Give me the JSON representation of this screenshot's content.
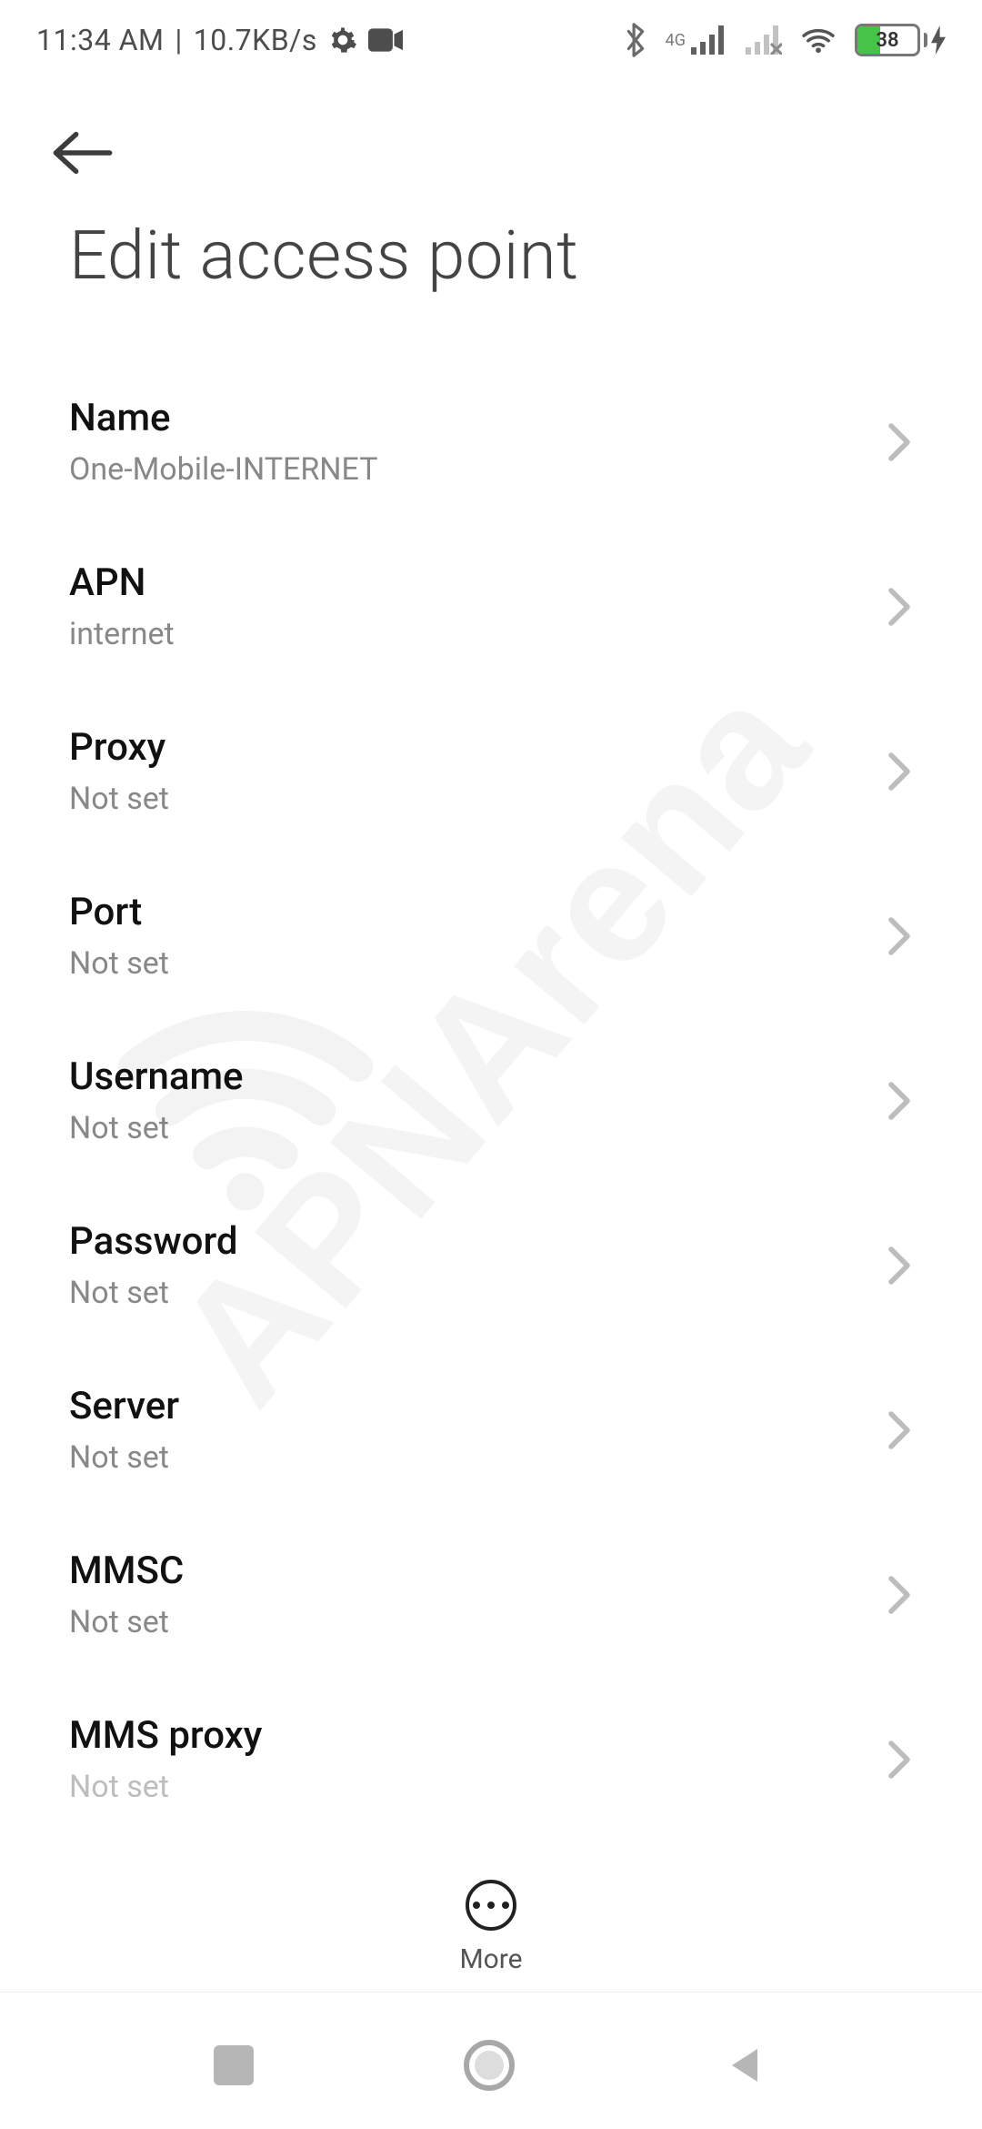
{
  "status": {
    "time": "11:34 AM",
    "network_rate": "10.7KB/s",
    "battery_percent": "38",
    "carrier_tag": "4G"
  },
  "page": {
    "title": "Edit access point",
    "settings": [
      {
        "key": "name",
        "label": "Name",
        "value": "One-Mobile-INTERNET"
      },
      {
        "key": "apn",
        "label": "APN",
        "value": "internet"
      },
      {
        "key": "proxy",
        "label": "Proxy",
        "value": "Not set"
      },
      {
        "key": "port",
        "label": "Port",
        "value": "Not set"
      },
      {
        "key": "username",
        "label": "Username",
        "value": "Not set"
      },
      {
        "key": "password",
        "label": "Password",
        "value": "Not set"
      },
      {
        "key": "server",
        "label": "Server",
        "value": "Not set"
      },
      {
        "key": "mmsc",
        "label": "MMSC",
        "value": "Not set"
      },
      {
        "key": "mms_proxy",
        "label": "MMS proxy",
        "value": "Not set"
      }
    ]
  },
  "footer": {
    "more_label": "More"
  },
  "watermark": "APNArena"
}
